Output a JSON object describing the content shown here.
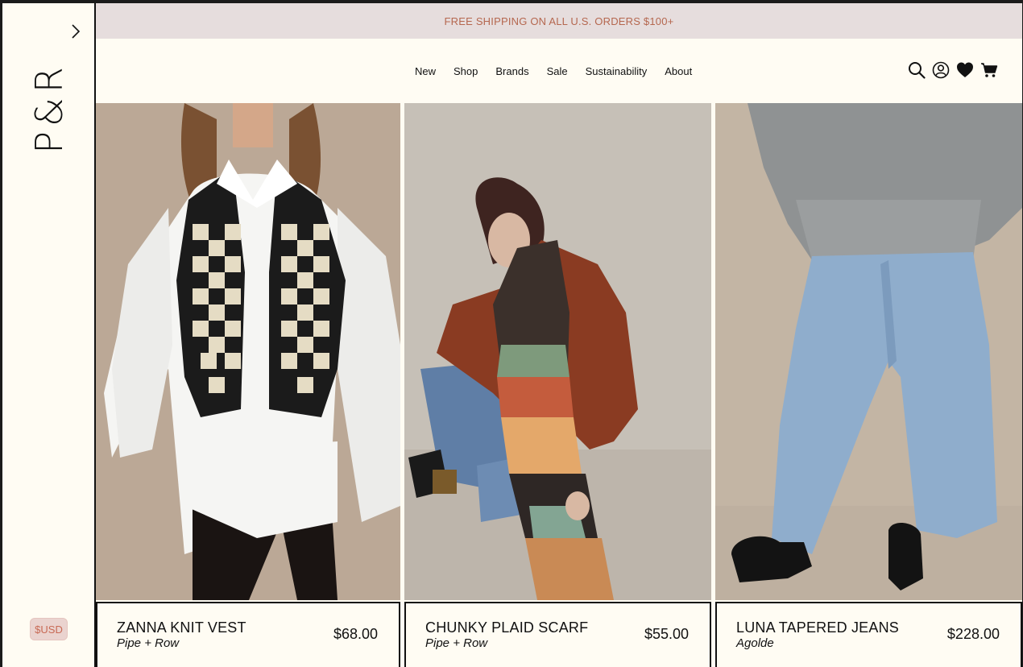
{
  "sidebar": {
    "logo": "P&R",
    "currency": "$USD"
  },
  "announcement": "FREE SHIPPING ON ALL U.S. ORDERS $100+",
  "nav": {
    "items": [
      "New",
      "Shop",
      "Brands",
      "Sale",
      "Sustainability",
      "About"
    ]
  },
  "header_icons": [
    "search-icon",
    "account-icon",
    "wishlist-heart-icon",
    "cart-icon"
  ],
  "products": [
    {
      "name": "ZANNA KNIT VEST",
      "brand": "Pipe + Row",
      "price": "$68.00"
    },
    {
      "name": "CHUNKY PLAID SCARF",
      "brand": "Pipe + Row",
      "price": "$55.00"
    },
    {
      "name": "LUNA TAPERED JEANS",
      "brand": "Agolde",
      "price": "$228.00"
    }
  ],
  "colors": {
    "background": "#fffcf3",
    "announcement_bg": "#e6dddd",
    "announcement_text": "#b5674f",
    "currency_bg": "#ead3cf"
  }
}
